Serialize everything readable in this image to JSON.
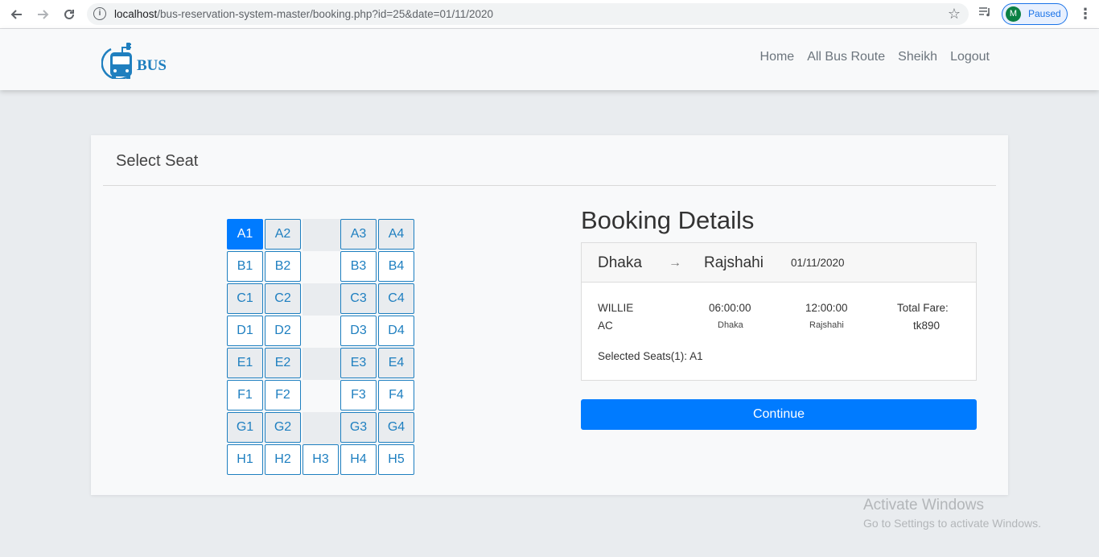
{
  "browser": {
    "url_host": "localhost",
    "url_path": "/bus-reservation-system-master/booking.php?id=25&date=01/11/2020",
    "profile_initial": "M",
    "profile_status": "Paused"
  },
  "navbar": {
    "logo_text": "BUS",
    "links": [
      "Home",
      "All Bus Route",
      "Sheikh",
      "Logout"
    ]
  },
  "card": {
    "title": "Select Seat"
  },
  "seat_rows": [
    {
      "seats": [
        "A1",
        "A2",
        "",
        "A3",
        "A4"
      ]
    },
    {
      "seats": [
        "B1",
        "B2",
        "",
        "B3",
        "B4"
      ]
    },
    {
      "seats": [
        "C1",
        "C2",
        "",
        "C3",
        "C4"
      ]
    },
    {
      "seats": [
        "D1",
        "D2",
        "",
        "D3",
        "D4"
      ]
    },
    {
      "seats": [
        "E1",
        "E2",
        "",
        "E3",
        "E4"
      ]
    },
    {
      "seats": [
        "F1",
        "F2",
        "",
        "F3",
        "F4"
      ]
    },
    {
      "seats": [
        "G1",
        "G2",
        "",
        "G3",
        "G4"
      ]
    },
    {
      "seats": [
        "H1",
        "H2",
        "H3",
        "H4",
        "H5"
      ]
    }
  ],
  "selected_seat": "A1",
  "booking": {
    "title": "Booking Details",
    "from": "Dhaka",
    "arrow": "→",
    "to": "Rajshahi",
    "date": "01/11/2020",
    "bus_name": "WILLIE",
    "bus_type": "AC",
    "departure_time": "06:00:00",
    "departure_place": "Dhaka",
    "arrival_time": "12:00:00",
    "arrival_place": "Rajshahi",
    "fare_label": "Total Fare:",
    "fare_value": "tk890",
    "selected_seats_text": "Selected Seats(1): A1",
    "continue_label": "Continue"
  },
  "watermark": {
    "line1": "Activate Windows",
    "line2": "Go to Settings to activate Windows."
  },
  "colors": {
    "accent": "#007bff",
    "seat_border": "#1e7fc0"
  }
}
